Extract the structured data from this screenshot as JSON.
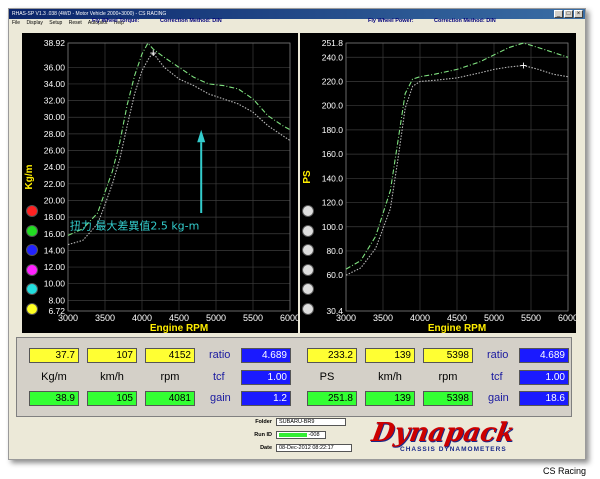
{
  "window": {
    "title": "RHAS-SP V1.3 .038  (4WD - Motor Vehicle 2000+3000) - CS RACING",
    "menu": [
      "File",
      "Display",
      "Setup",
      "Reset",
      "Autopilot",
      "Help"
    ]
  },
  "left_panel": {
    "header_left": "Fly Wheel Torque:",
    "header_right": "Correction Method: DIN"
  },
  "right_panel": {
    "header_left": "Fly Wheel Power:",
    "header_right": "Correction Method: DIN"
  },
  "indicators": {
    "left_colors": [
      "#ff2222",
      "#22dd22",
      "#2222ff",
      "#ff22ff",
      "#22dddd",
      "#ffff22"
    ],
    "right_colors": [
      "#dddddd",
      "#dddddd",
      "#dddddd",
      "#dddddd",
      "#dddddd",
      "#dddddd"
    ]
  },
  "chart_data": [
    {
      "type": "line",
      "title": "",
      "xlabel": "Engine RPM",
      "ylabel": "Kg/m",
      "xlim": [
        3000,
        6000
      ],
      "ylim": [
        6.72,
        38.92
      ],
      "x_ticks": [
        "3000",
        "3500",
        "4000",
        "4500",
        "5000",
        "5500",
        "6000"
      ],
      "y_ticks": [
        "38.92",
        "36.00",
        "34.00",
        "32.00",
        "30.00",
        "28.00",
        "26.00",
        "24.00",
        "22.00",
        "20.00",
        "18.00",
        "16.00",
        "14.00",
        "12.00",
        "10.00",
        "8.00",
        "6.72"
      ],
      "grid": true,
      "series": [
        {
          "color": "#7fe07f",
          "x": [
            3000,
            3200,
            3400,
            3500,
            3600,
            3700,
            3800,
            3900,
            4000,
            4080,
            4150,
            4300,
            4500,
            4700,
            4900,
            5100,
            5300,
            5500,
            5700,
            5900,
            6000
          ],
          "y": [
            15.8,
            16.6,
            18.5,
            21.0,
            23.5,
            27.0,
            31.5,
            35.0,
            37.6,
            38.9,
            38.2,
            37.2,
            36.0,
            34.8,
            34.0,
            33.8,
            33.4,
            32.2,
            30.2,
            29.0,
            28.5
          ]
        },
        {
          "color": "#b8b8b8",
          "x": [
            3000,
            3200,
            3400,
            3500,
            3600,
            3700,
            3800,
            3900,
            4000,
            4100,
            4152,
            4300,
            4500,
            4700,
            4900,
            5100,
            5300,
            5500,
            5700,
            5900,
            6000
          ],
          "y": [
            14.7,
            15.2,
            17.2,
            19.5,
            22.0,
            25.0,
            29.0,
            32.8,
            35.6,
            37.2,
            37.7,
            36.0,
            34.6,
            33.8,
            32.8,
            32.2,
            31.6,
            30.6,
            29.0,
            27.8,
            27.2
          ]
        }
      ],
      "markers": [
        {
          "x": 4152,
          "y": 37.7,
          "symbol": "+"
        }
      ],
      "annotation": {
        "text": "扭力 最大差異值2.5 kg-m",
        "arrow_direction": "up",
        "color": "#33cccc"
      }
    },
    {
      "type": "line",
      "title": "",
      "xlabel": "Engine RPM",
      "ylabel": "PS",
      "xlim": [
        3000,
        6000
      ],
      "ylim": [
        30.4,
        251.8
      ],
      "x_ticks": [
        "3000",
        "3500",
        "4000",
        "4500",
        "5000",
        "5500",
        "6000"
      ],
      "y_ticks": [
        "251.8",
        "240.0",
        "220.0",
        "200.0",
        "180.0",
        "160.0",
        "140.0",
        "120.0",
        "100.0",
        "80.0",
        "60.0",
        "30.4"
      ],
      "grid": true,
      "series": [
        {
          "color": "#7fe07f",
          "x": [
            3000,
            3200,
            3400,
            3600,
            3700,
            3800,
            3900,
            4000,
            4200,
            4500,
            4800,
            5000,
            5200,
            5398,
            5600,
            5800,
            6000
          ],
          "y": [
            65,
            72,
            92,
            130,
            170,
            210,
            222,
            224,
            226,
            230,
            236,
            242,
            248,
            251.8,
            248,
            244,
            240
          ]
        },
        {
          "color": "#b8b8b8",
          "x": [
            3000,
            3200,
            3400,
            3600,
            3700,
            3800,
            3900,
            4000,
            4200,
            4500,
            4800,
            5000,
            5200,
            5398,
            5600,
            5800,
            6000
          ],
          "y": [
            60,
            66,
            82,
            115,
            155,
            198,
            216,
            220,
            221,
            223,
            227,
            230,
            232,
            233.2,
            230,
            226,
            224
          ]
        }
      ],
      "markers": [
        {
          "x": 5398,
          "y": 233.2,
          "symbol": "+"
        }
      ]
    }
  ],
  "readouts": {
    "left": {
      "row1": [
        "37.7",
        "107",
        "4152"
      ],
      "labels": [
        "Kg/m",
        "km/h",
        "rpm"
      ],
      "row3": [
        "38.9",
        "105",
        "4081"
      ],
      "ratio_label": "ratio",
      "ratio_value": "4.689",
      "tcf_label": "tcf",
      "tcf_value": "1.00",
      "gain_label": "gain",
      "gain_value": "1.2"
    },
    "right": {
      "row1": [
        "233.2",
        "139",
        "5398"
      ],
      "labels": [
        "PS",
        "km/h",
        "rpm"
      ],
      "row3": [
        "251.8",
        "139",
        "5398"
      ],
      "ratio_label": "ratio",
      "ratio_value": "4.689",
      "tcf_label": "tcf",
      "tcf_value": "1.00",
      "gain_label": "gain",
      "gain_value": "18.6"
    }
  },
  "run_info": {
    "folder_label": "Folder",
    "folder_value": "SUBARU-BR9",
    "run_label": "Run ID",
    "run_value": "-008",
    "date_label": "Date",
    "date_value": "08-Dec-2012  08:22:17"
  },
  "logo": {
    "brand": "Dynapack",
    "tagline": "CHASSIS DYNAMOMETERS"
  },
  "credit": "CS Racing"
}
